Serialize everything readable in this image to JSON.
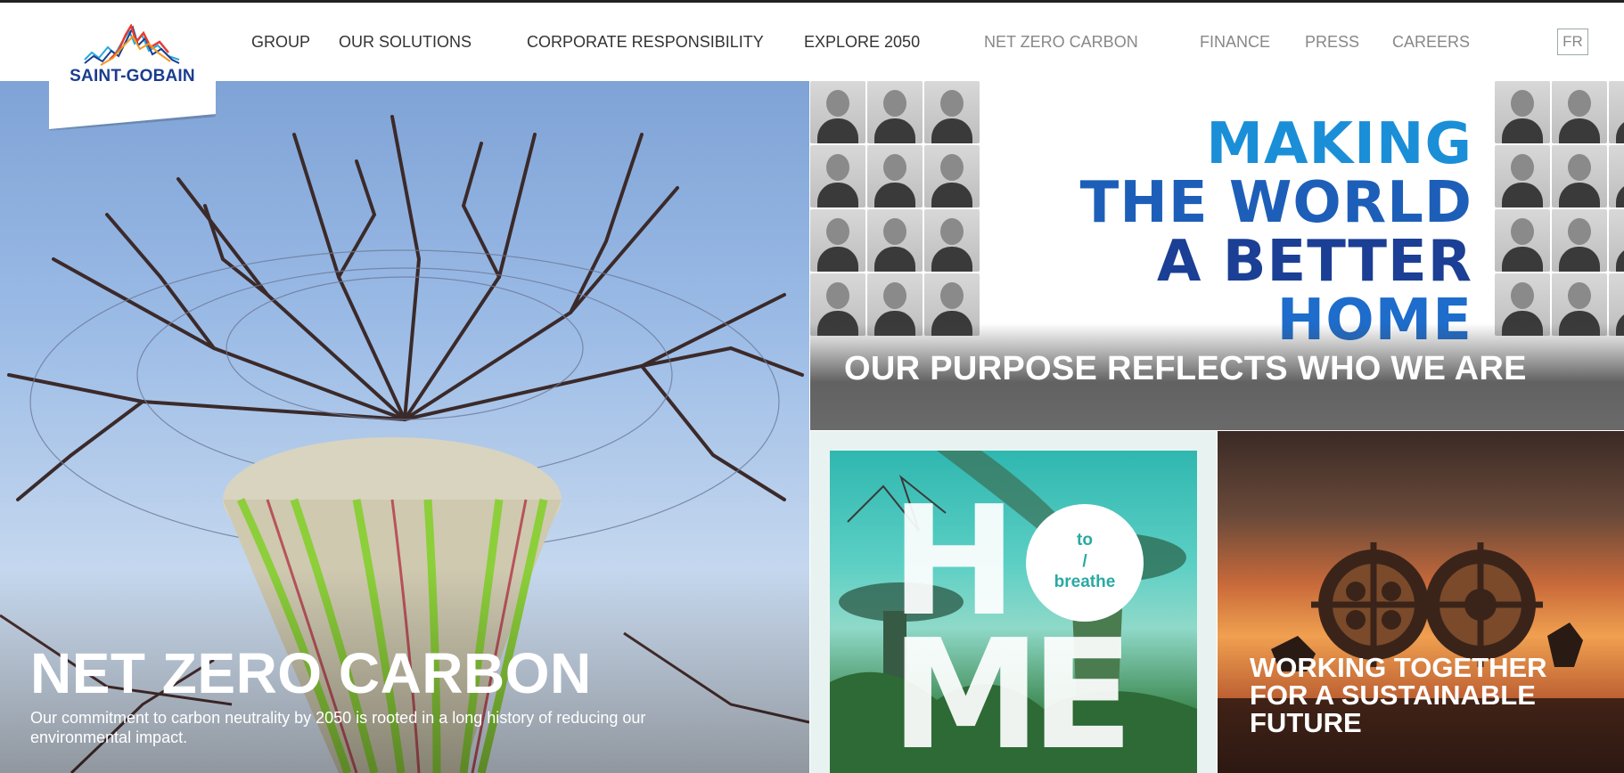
{
  "brand": {
    "name": "SAINT-GOBAIN",
    "colors": {
      "logo_blue": "#1b3d8f",
      "logo_red": "#e63c2e",
      "logo_orange": "#f29a1f",
      "logo_cyan": "#29a8e0"
    }
  },
  "nav": {
    "items": [
      {
        "label": "GROUP"
      },
      {
        "label": "OUR SOLUTIONS"
      },
      {
        "label": "CORPORATE RESPONSIBILITY"
      },
      {
        "label": "EXPLORE 2050"
      },
      {
        "label": "NET ZERO CARBON"
      },
      {
        "label": "FINANCE"
      },
      {
        "label": "PRESS"
      },
      {
        "label": "CAREERS"
      }
    ],
    "language": "FR"
  },
  "hero": {
    "title": "NET ZERO CARBON",
    "description": "Our commitment to carbon neutrality by 2050 is rooted in a long history of reducing our environmental impact."
  },
  "purpose": {
    "slogan": [
      "MAKING",
      "THE WORLD",
      "A BETTER",
      "HOME"
    ],
    "title": "OUR PURPOSE REFLECTS WHO WE ARE"
  },
  "breathe": {
    "letters": [
      "H",
      "M",
      "E"
    ],
    "circle": [
      "to",
      "/",
      "breathe"
    ]
  },
  "working": {
    "title_lines": [
      "WORKING TOGETHER",
      "FOR A SUSTAINABLE",
      "FUTURE"
    ]
  }
}
